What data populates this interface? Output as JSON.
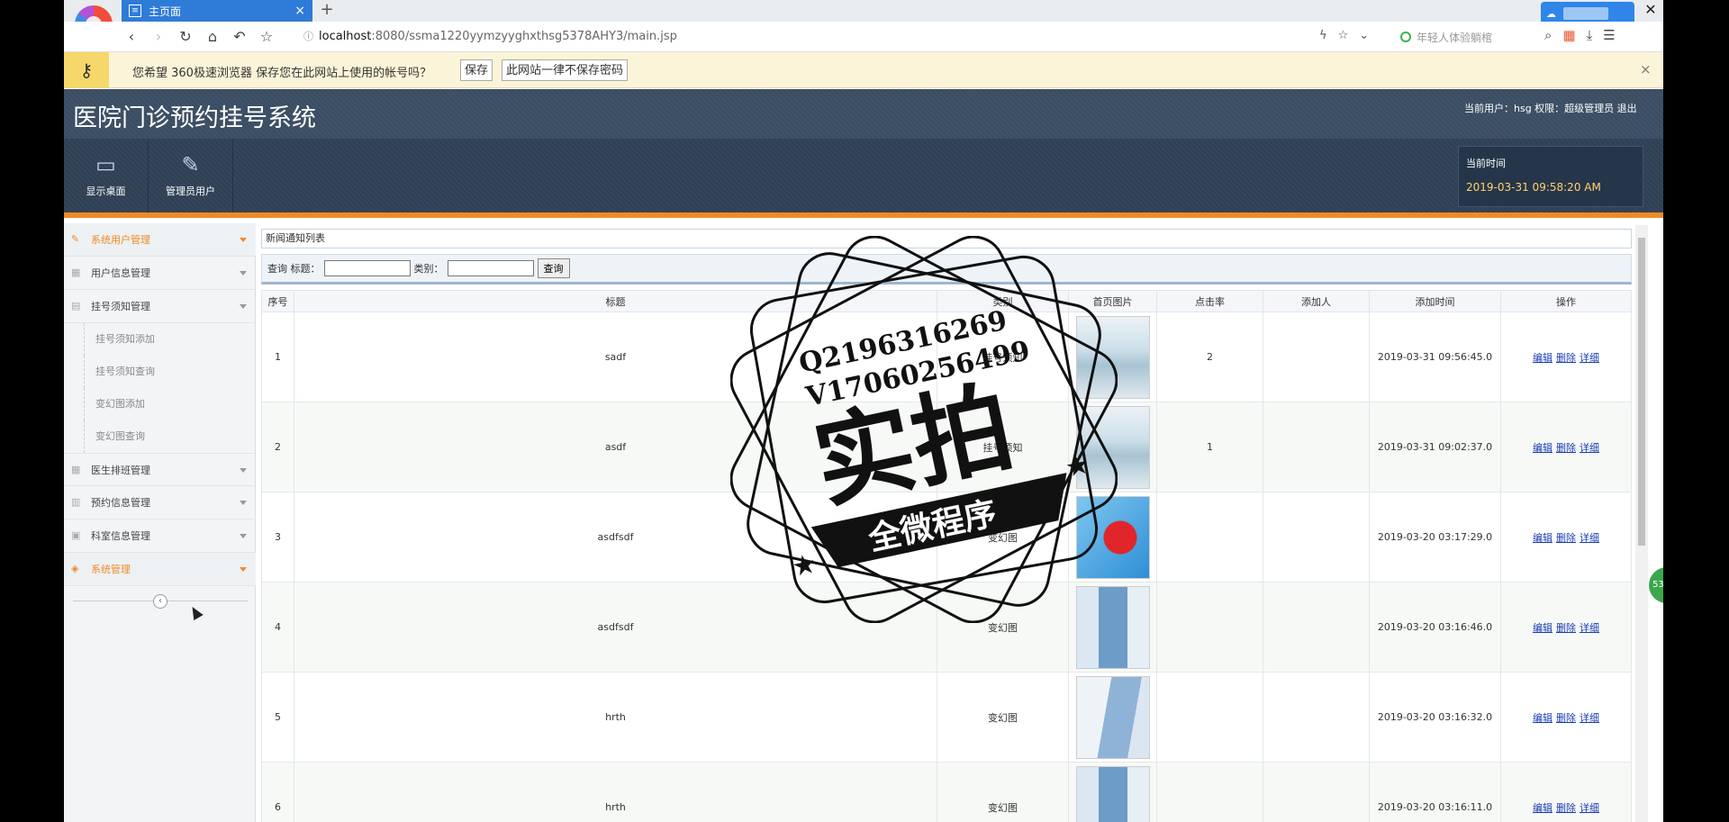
{
  "browser": {
    "tab_title": "主页面",
    "tab_close": "×",
    "new_tab": "+",
    "url_host": "localhost",
    "url_rest": ":8080/ssma1220yymzyyghxthsg5378AHY3/main.jsp",
    "search_placeholder": "年轻人体验躺棺",
    "window_close": "✕"
  },
  "password_bar": {
    "message": "您希望 360极速浏览器 保存您在此网站上使用的帐号吗？",
    "save_label": "保存",
    "never_label": "此网站一律不保存密码",
    "close": "×"
  },
  "header": {
    "title": "医院门诊预约挂号系统",
    "user_info": "当前用户：hsg 权限：超级管理员 退出"
  },
  "toolbar": {
    "desktop_label": "显示桌面",
    "admin_label": "管理员用户",
    "clock_title": "当前时间",
    "clock_value": "2019-03-31 09:58:20 AM"
  },
  "sidebar": {
    "items": [
      {
        "label": "系统用户管理"
      },
      {
        "label": "用户信息管理"
      },
      {
        "label": "挂号须知管理"
      },
      {
        "label": "医生排班管理"
      },
      {
        "label": "预约信息管理"
      },
      {
        "label": "科室信息管理"
      },
      {
        "label": "系统管理"
      }
    ],
    "subitems": [
      {
        "label": "挂号须知添加"
      },
      {
        "label": "挂号须知查询"
      },
      {
        "label": "变幻图添加"
      },
      {
        "label": "变幻图查询"
      }
    ]
  },
  "main": {
    "panel_title": "新闻通知列表",
    "search": {
      "prefix": "查询 标题：",
      "category_label": "类别：",
      "button": "查询"
    },
    "columns": [
      "序号",
      "标题",
      "类别",
      "首页图片",
      "点击率",
      "添加人",
      "添加时间",
      "操作"
    ],
    "rows": [
      {
        "no": "1",
        "title": "sadf",
        "category": "挂号须知",
        "clicks": "2",
        "adder": "",
        "time": "2019-03-31 09:56:45.0"
      },
      {
        "no": "2",
        "title": "asdf",
        "category": "挂号须知",
        "clicks": "1",
        "adder": "",
        "time": "2019-03-31 09:02:37.0"
      },
      {
        "no": "3",
        "title": "asdfsdf",
        "category": "变幻图",
        "clicks": "",
        "adder": "",
        "time": "2019-03-20 03:17:29.0"
      },
      {
        "no": "4",
        "title": "asdfsdf",
        "category": "变幻图",
        "clicks": "",
        "adder": "",
        "time": "2019-03-20 03:16:46.0"
      },
      {
        "no": "5",
        "title": "hrth",
        "category": "变幻图",
        "clicks": "",
        "adder": "",
        "time": "2019-03-20 03:16:32.0"
      },
      {
        "no": "6",
        "title": "hrth",
        "category": "变幻图",
        "clicks": "",
        "adder": "",
        "time": "2019-03-20 03:16:11.0"
      }
    ],
    "ops": {
      "edit": "编辑",
      "delete": "删除",
      "detail": "详细"
    }
  },
  "stamp": {
    "line1": "Q2196316269",
    "line2": "V17060256499",
    "big": "实拍",
    "banner": "全微程序"
  },
  "badge": "53"
}
